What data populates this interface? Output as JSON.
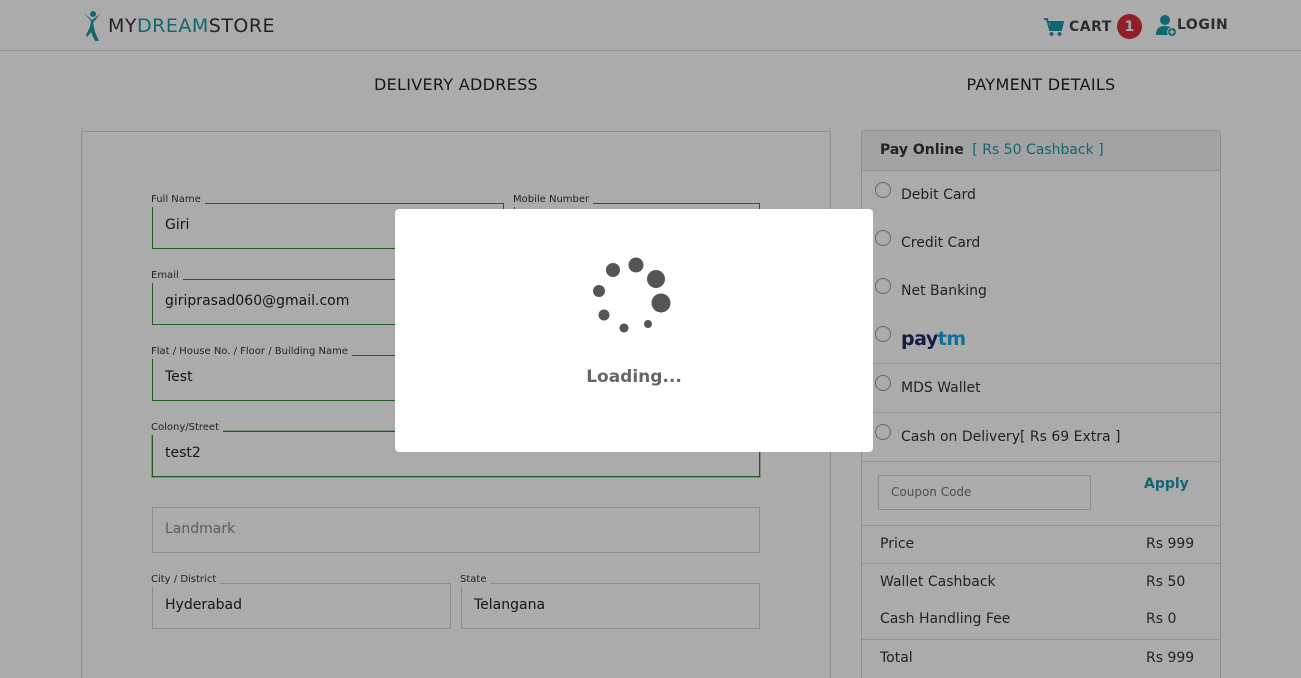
{
  "header": {
    "logo_my": "MY",
    "logo_dream": "DREAM",
    "logo_store": "STORE",
    "cart_label": "CART",
    "cart_count": "1",
    "login_label": "LOGIN"
  },
  "sections": {
    "delivery_title": "DELIVERY ADDRESS",
    "payment_title": "PAYMENT DETAILS"
  },
  "address": {
    "full_name": {
      "label": "Full Name",
      "value": "Giri"
    },
    "mobile": {
      "label": "Mobile Number",
      "value": ""
    },
    "email": {
      "label": "Email",
      "value": "giriprasad060@gmail.com"
    },
    "flat": {
      "label": "Flat / House No. / Floor / Building Name",
      "value": "Test"
    },
    "street": {
      "label": "Colony/Street",
      "value": "test2"
    },
    "landmark": {
      "placeholder": "Landmark"
    },
    "city": {
      "label": "City / District",
      "value": "Hyderabad"
    },
    "state": {
      "label": "State",
      "value": "Telangana"
    }
  },
  "payment": {
    "pay_online": "Pay Online",
    "cashback_note": "[ Rs 50 Cashback ]",
    "options": {
      "debit": "Debit Card",
      "credit": "Credit Card",
      "netbanking": "Net Banking",
      "paytm_pay": "pay",
      "paytm_tm": "tm",
      "wallet": "MDS Wallet",
      "cod": "Cash on Delivery[ Rs 69 Extra ]"
    },
    "coupon_placeholder": "Coupon Code",
    "apply_label": "Apply",
    "summary": {
      "price_label": "Price",
      "price_value": "Rs 999",
      "cashback_label": "Wallet Cashback",
      "cashback_value": "Rs 50",
      "handling_label": "Cash Handling Fee",
      "handling_value": "Rs 0",
      "total_label": "Total",
      "total_value": "Rs 999"
    }
  },
  "modal": {
    "loading_text": "Loading..."
  },
  "colors": {
    "brand_teal": "#1a98a8",
    "badge_red": "#d9303a",
    "field_focus_green": "#2e8b2e",
    "overlay": "rgba(0,0,0,0.33)"
  },
  "icons": {
    "logo": "dancer-logo-icon",
    "cart": "cart-icon",
    "login": "user-add-icon",
    "spinner": "loading-spinner-icon"
  }
}
